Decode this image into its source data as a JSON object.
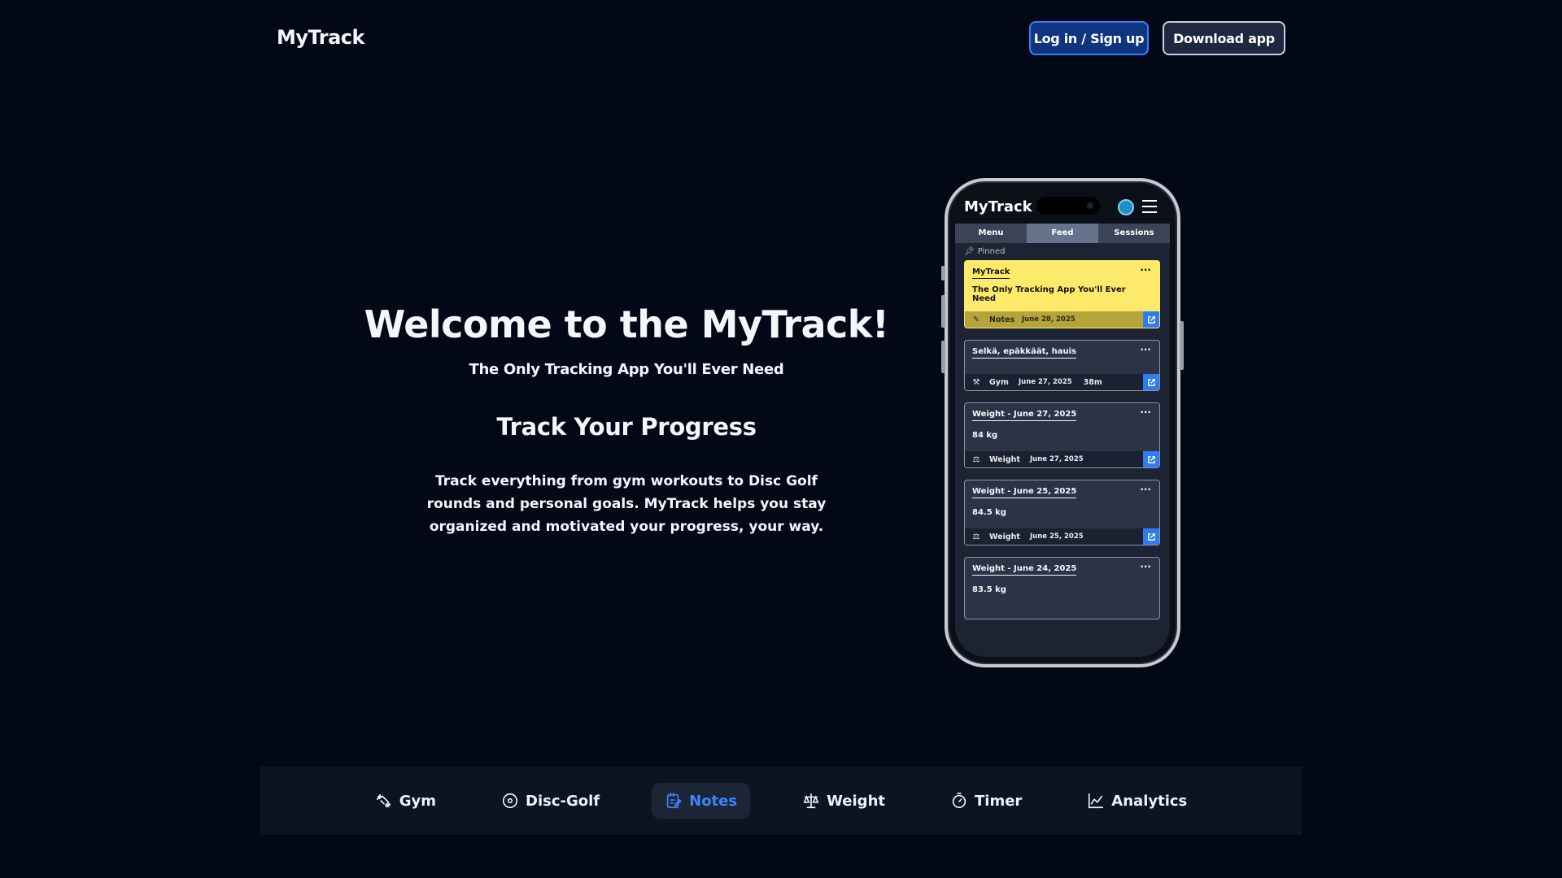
{
  "header": {
    "brand": "MyTrack",
    "login_label": "Log in / Sign up",
    "download_label": "Download app"
  },
  "hero": {
    "title": "Welcome to the MyTrack!",
    "subtitle": "The Only Tracking App You'll Ever Need",
    "heading": "Track Your Progress",
    "description": "Track everything from gym workouts to Disc Golf rounds and personal goals. MyTrack helps you stay organized and motivated your progress, your way."
  },
  "phone": {
    "app_title": "MyTrack",
    "tabs": [
      "Menu",
      "Feed",
      "Sessions"
    ],
    "active_tab": "Feed",
    "pinned_label": "Pinned",
    "cards": [
      {
        "title": "MyTrack",
        "body": "The Only Tracking App You'll Ever Need",
        "category": "Notes",
        "date": "June 28, 2025",
        "duration": "",
        "style": "yellow",
        "icon": "notes-icon"
      },
      {
        "title": "Selkä, epäkkäät, hauis",
        "body": "",
        "category": "Gym",
        "date": "June 27, 2025",
        "duration": "38m",
        "style": "dark",
        "icon": "gym-icon"
      },
      {
        "title": "Weight - June 27, 2025",
        "body": "84 kg",
        "category": "Weight",
        "date": "June 27, 2025",
        "duration": "",
        "style": "dark",
        "icon": "scale-icon"
      },
      {
        "title": "Weight - June 25, 2025",
        "body": "84.5 kg",
        "category": "Weight",
        "date": "June 25, 2025",
        "duration": "",
        "style": "dark",
        "icon": "scale-icon"
      },
      {
        "title": "Weight - June 24, 2025",
        "body": "83.5 kg",
        "category": "",
        "date": "",
        "duration": "",
        "style": "dark",
        "icon": ""
      }
    ]
  },
  "bottom_nav": {
    "items": [
      {
        "label": "Gym",
        "icon": "dumbbell-icon"
      },
      {
        "label": "Disc-Golf",
        "icon": "disc-icon"
      },
      {
        "label": "Notes",
        "icon": "notes-icon"
      },
      {
        "label": "Weight",
        "icon": "scale-icon"
      },
      {
        "label": "Timer",
        "icon": "timer-icon"
      },
      {
        "label": "Analytics",
        "icon": "chart-icon"
      }
    ],
    "active": "Notes"
  },
  "colors": {
    "background": "#030817",
    "accent": "#3b86ff",
    "pinned_card": "#fde96a"
  }
}
